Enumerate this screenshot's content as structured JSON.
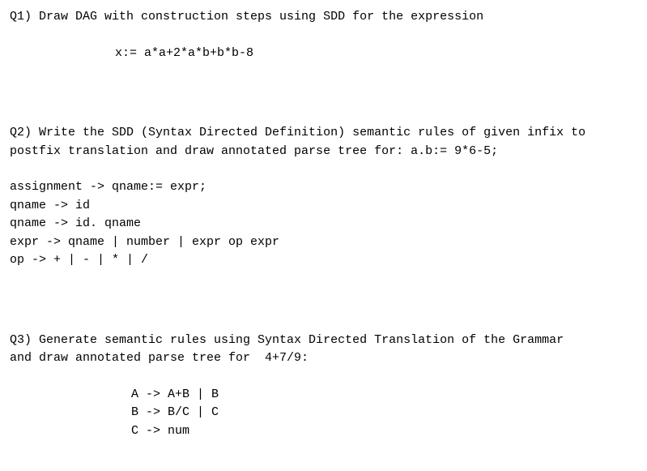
{
  "q1": {
    "prompt": "Q1) Draw DAG with construction steps using SDD for the expression",
    "expression": "x:= a*a+2*a*b+b*b-8"
  },
  "q2": {
    "prompt_line1": "Q2) Write the SDD (Syntax Directed Definition) semantic rules of given infix to",
    "prompt_line2": "postfix translation and draw annotated parse tree for: a.b:= 9*6-5;",
    "grammar": [
      "assignment -> qname:= expr;",
      "qname -> id",
      "qname -> id. qname",
      "expr -> qname | number | expr op expr",
      "op -> + | - | * | /"
    ]
  },
  "q3": {
    "prompt_line1": "Q3) Generate semantic rules using Syntax Directed Translation of the Grammar",
    "prompt_line2": "and draw annotated parse tree for  4+7/9:",
    "grammar": [
      "A -> A+B | B",
      "B -> B/C | C",
      "C -> num"
    ]
  }
}
